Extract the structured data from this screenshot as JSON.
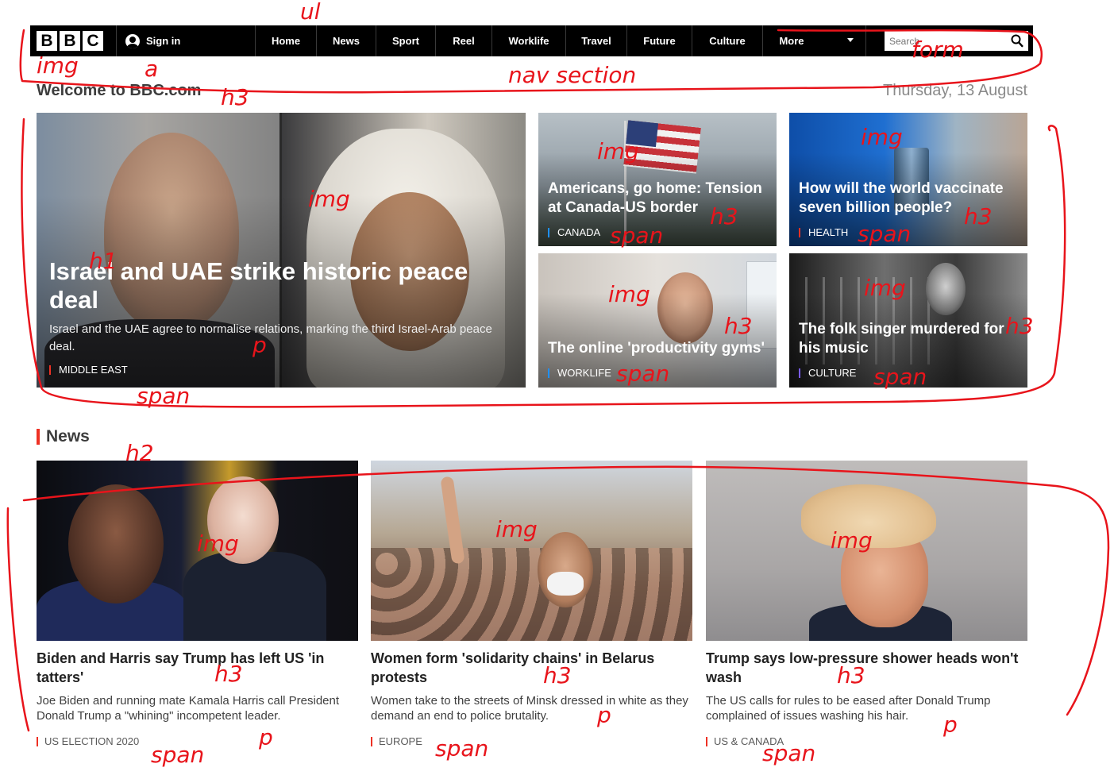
{
  "nav": {
    "logo_letters": [
      "B",
      "B",
      "C"
    ],
    "sign_in_label": "Sign in",
    "items": [
      {
        "label": "Home"
      },
      {
        "label": "News"
      },
      {
        "label": "Sport"
      },
      {
        "label": "Reel"
      },
      {
        "label": "Worklife"
      },
      {
        "label": "Travel"
      },
      {
        "label": "Future"
      },
      {
        "label": "Culture"
      },
      {
        "label": "More"
      }
    ],
    "search_placeholder": "Search",
    "icons": [
      "user-icon",
      "chevron-down-icon",
      "search-icon"
    ]
  },
  "welcome": {
    "title": "Welcome to BBC.com",
    "date": "Thursday, 13 August"
  },
  "hero": {
    "headline": "Israel and UAE strike historic peace deal",
    "summary": "Israel and the UAE agree to normalise relations, marking the third Israel-Arab peace deal.",
    "tag": "MIDDLE EAST"
  },
  "promos": [
    {
      "headline": "Americans, go home: Tension at Canada-US border",
      "tag": "CANADA"
    },
    {
      "headline": "How will the world vaccinate seven billion people?",
      "tag": "HEALTH"
    },
    {
      "headline": "The online 'productivity gyms'",
      "tag": "WORKLIFE"
    },
    {
      "headline": "The folk singer murdered for his music",
      "tag": "CULTURE"
    }
  ],
  "news": {
    "heading": "News",
    "items": [
      {
        "headline": "Biden and Harris say Trump has left US 'in tatters'",
        "summary": "Joe Biden and running mate Kamala Harris call President Donald Trump a \"whining\" incompetent leader.",
        "tag": "US ELECTION 2020"
      },
      {
        "headline": "Women form 'solidarity chains' in Belarus protests",
        "summary": "Women take to the streets of Minsk dressed in white as they demand an end to police brutality.",
        "tag": "EUROPE"
      },
      {
        "headline": "Trump says low-pressure shower heads won't wash",
        "summary": "The US calls for rules to be eased after Donald Trump complained of issues washing his hair.",
        "tag": "US & CANADA"
      }
    ]
  },
  "annotations": {
    "color": "#e8141b",
    "labels": [
      "ul",
      "img",
      "a",
      "nav section",
      "form",
      "h3",
      "img",
      "h1",
      "p",
      "span",
      "img",
      "h3",
      "span",
      "img",
      "h3",
      "span",
      "img",
      "h3",
      "span",
      "img",
      "h3",
      "span",
      "h2",
      "img",
      "img",
      "img",
      "h3",
      "h3",
      "h3",
      "p",
      "p",
      "p",
      "span",
      "span",
      "span"
    ]
  }
}
